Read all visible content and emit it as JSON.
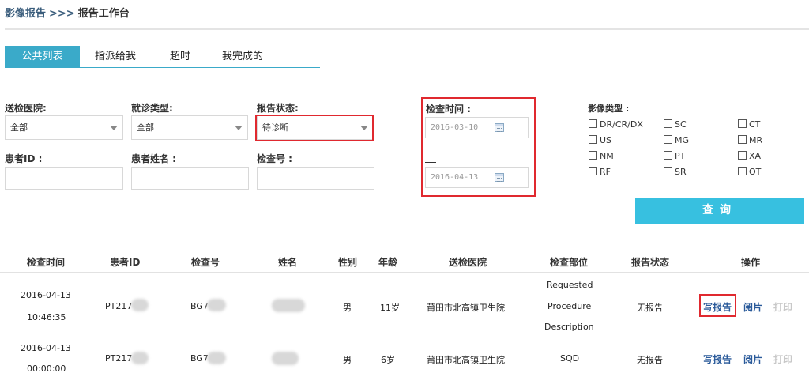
{
  "breadcrumb": {
    "root": "影像报告",
    "separator": ">>>",
    "current": "报告工作台"
  },
  "tabs": [
    "公共列表",
    "指派给我",
    "超时",
    "我完成的"
  ],
  "filters": {
    "hospital": {
      "label": "送检医院:",
      "value": "全部"
    },
    "visit_type": {
      "label": "就诊类型:",
      "value": "全部"
    },
    "report_status": {
      "label": "报告状态:",
      "value": "待诊断"
    },
    "patient_id": {
      "label": "患者ID :"
    },
    "patient_name": {
      "label": "患者姓名 :"
    },
    "exam_no": {
      "label": "检查号 :"
    },
    "exam_time": {
      "label": "检查时间 :",
      "start": "2016-03-10",
      "end": "2016-04-13"
    },
    "modality": {
      "label": "影像类型 :",
      "options": [
        "DR/CR/DX",
        "SC",
        "CT",
        "US",
        "MG",
        "MR",
        "NM",
        "PT",
        "XA",
        "RF",
        "SR",
        "OT"
      ]
    },
    "query_label": "查询"
  },
  "table": {
    "headers": [
      "检查时间",
      "患者ID",
      "检查号",
      "姓名",
      "性别",
      "年龄",
      "送检医院",
      "检查部位",
      "报告状态",
      "操作"
    ],
    "rows": [
      {
        "date": "2016-04-13",
        "time": "10:46:35",
        "patient_id": "PT217",
        "exam_no": "BG7",
        "gender": "男",
        "age": "11岁",
        "hospital": "莆田市北高镇卫生院",
        "body_part_lines": [
          "Requested",
          "Procedure",
          "Description"
        ],
        "status": "无报告",
        "actions": [
          "写报告",
          "阅片",
          "打印"
        ]
      },
      {
        "date": "2016-04-13",
        "time": "00:00:00",
        "patient_id": "PT217",
        "exam_no": "BG7",
        "gender": "男",
        "age": "6岁",
        "hospital": "莆田市北高镇卫生院",
        "body_part_lines": [
          "SQD"
        ],
        "status": "无报告",
        "actions": [
          "写报告",
          "阅片",
          "打印"
        ]
      }
    ]
  },
  "colors": {
    "accent": "#3aaac9",
    "button": "#37c0e0",
    "highlight": "#e0292f",
    "link": "#2a5a9a"
  }
}
